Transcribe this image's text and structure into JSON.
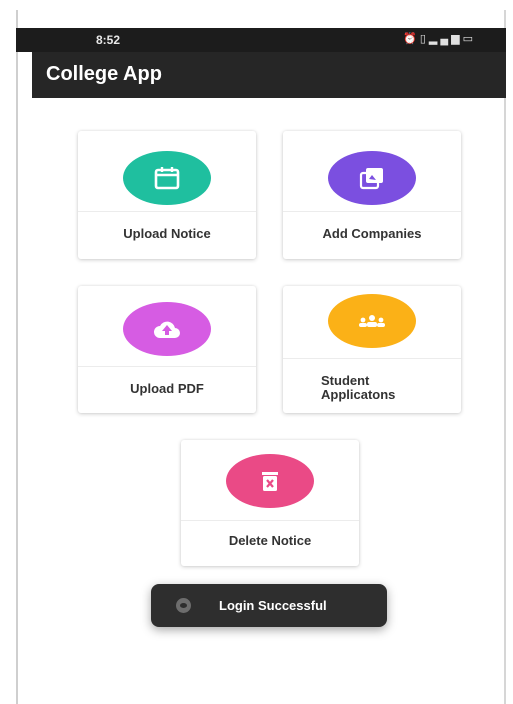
{
  "status_bar": {
    "time": "8:52",
    "icons": [
      "alarm-icon",
      "vibrate-icon",
      "signal-icon",
      "battery-icon"
    ]
  },
  "app_bar": {
    "title": "College App"
  },
  "cards": [
    {
      "label": "Upload Notice",
      "icon": "calendar-icon",
      "color": "#1fbf9f"
    },
    {
      "label": "Add Companies",
      "icon": "image-icon",
      "color": "#7b4fe0"
    },
    {
      "label": "Upload PDF",
      "icon": "cloud-upload-icon",
      "color": "#d65ce3"
    },
    {
      "label": "Student Applicatons",
      "icon": "group-icon",
      "color": "#fbb117"
    },
    {
      "label": "Delete Notice",
      "icon": "delete-icon",
      "color": "#ea4a86"
    }
  ],
  "toast": {
    "message": "Login Successful",
    "icon": "app-icon"
  }
}
